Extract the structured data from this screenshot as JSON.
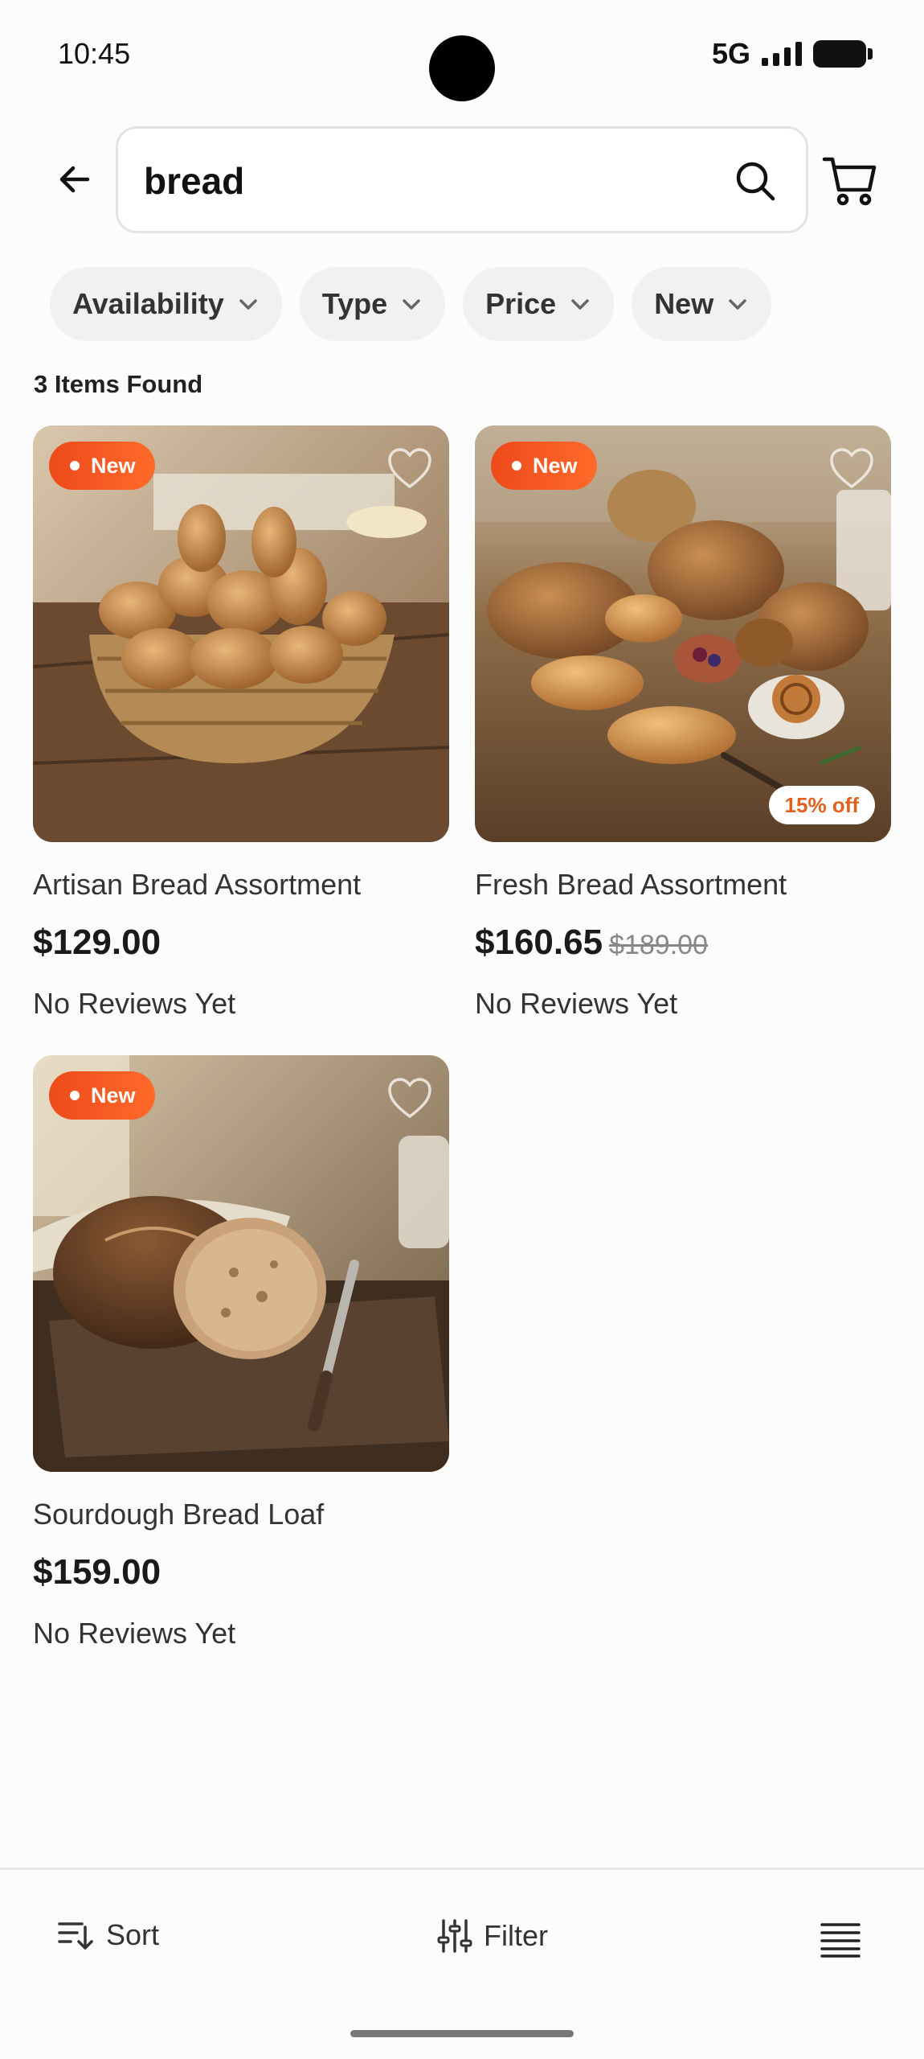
{
  "status_bar": {
    "time": "10:45",
    "network": "5G"
  },
  "search": {
    "query": "bread"
  },
  "filters": [
    {
      "label": "Availability"
    },
    {
      "label": "Type"
    },
    {
      "label": "Price"
    },
    {
      "label": "New"
    }
  ],
  "results": {
    "count_text": "3 Items Found"
  },
  "products": [
    {
      "badge": "New",
      "name": "Artisan Bread Assortment",
      "price": "$129.00",
      "old_price": "",
      "discount": "",
      "reviews": "No Reviews Yet"
    },
    {
      "badge": "New",
      "name": "Fresh Bread Assortment",
      "price": "$160.65",
      "old_price": "$189.00",
      "discount": "15% off",
      "reviews": "No Reviews Yet"
    },
    {
      "badge": "New",
      "name": "Sourdough Bread Loaf",
      "price": "$159.00",
      "old_price": "",
      "discount": "",
      "reviews": "No Reviews Yet"
    }
  ],
  "bottom_bar": {
    "sort_label": "Sort",
    "filter_label": "Filter"
  },
  "colors": {
    "badge": "#ee4a1b",
    "discount_text": "#e0621f",
    "chip_bg": "#f1f0f2"
  },
  "icons": [
    "back-arrow-icon",
    "search-icon",
    "cart-icon",
    "chevron-down-icon",
    "heart-icon",
    "sort-icon",
    "filter-sliders-icon",
    "list-view-icon"
  ]
}
